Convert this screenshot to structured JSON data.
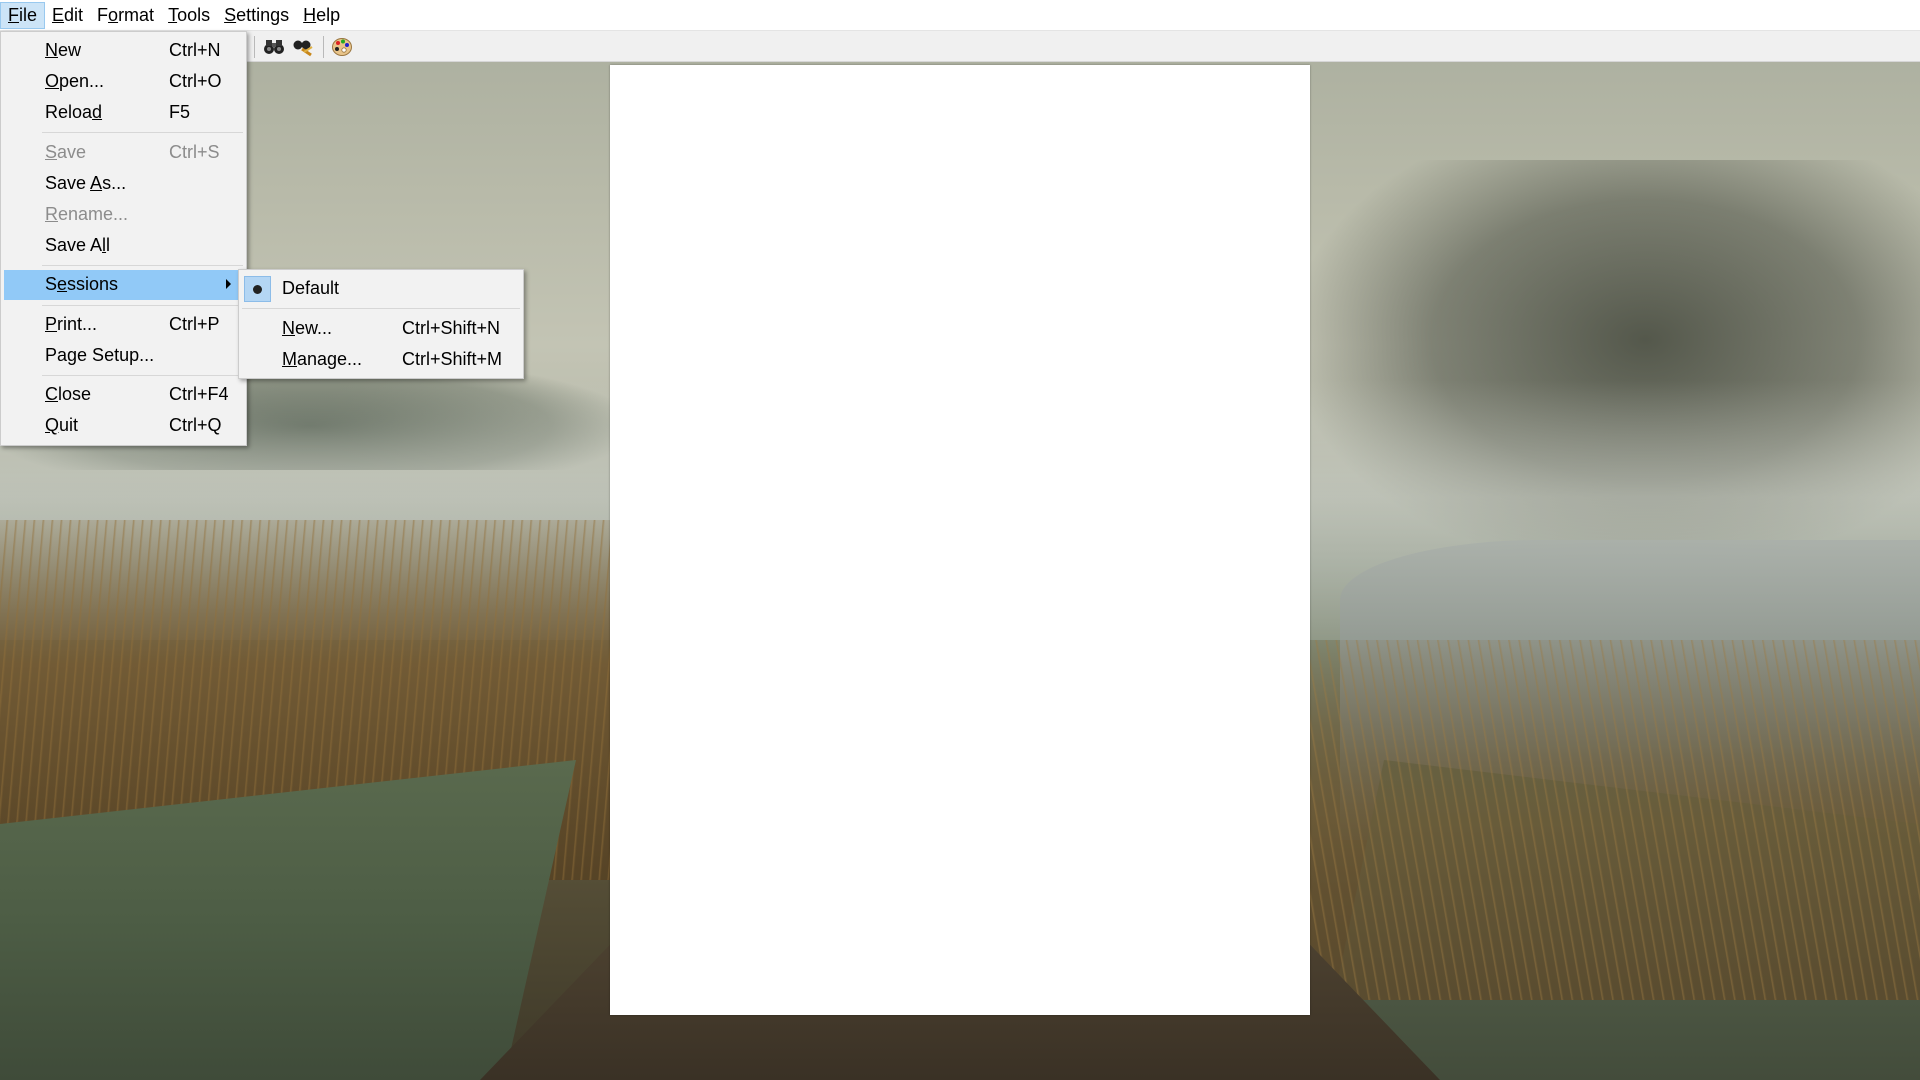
{
  "menubar": {
    "items": [
      {
        "pre": "",
        "mn": "F",
        "post": "ile"
      },
      {
        "pre": "",
        "mn": "E",
        "post": "dit"
      },
      {
        "pre": "F",
        "mn": "o",
        "post": "rmat"
      },
      {
        "pre": "",
        "mn": "T",
        "post": "ools"
      },
      {
        "pre": "",
        "mn": "S",
        "post": "ettings"
      },
      {
        "pre": "",
        "mn": "H",
        "post": "elp"
      }
    ]
  },
  "toolbar": {
    "icons": [
      "find-binoculars-icon",
      "find-replace-icon",
      "color-palette-icon"
    ]
  },
  "file_menu": {
    "new": {
      "pre": "",
      "mn": "N",
      "post": "ew",
      "shortcut": "Ctrl+N"
    },
    "open": {
      "pre": "",
      "mn": "O",
      "post": "pen...",
      "shortcut": "Ctrl+O"
    },
    "reload": {
      "pre": "Reloa",
      "mn": "d",
      "post": "",
      "shortcut": "F5"
    },
    "save": {
      "pre": "",
      "mn": "S",
      "post": "ave",
      "shortcut": "Ctrl+S"
    },
    "save_as": {
      "pre": "Save ",
      "mn": "A",
      "post": "s...",
      "shortcut": ""
    },
    "rename": {
      "pre": "",
      "mn": "R",
      "post": "ename...",
      "shortcut": ""
    },
    "save_all": {
      "pre": "Save A",
      "mn": "l",
      "post": "l",
      "shortcut": ""
    },
    "sessions": {
      "pre": "S",
      "mn": "e",
      "post": "ssions"
    },
    "print": {
      "pre": "",
      "mn": "P",
      "post": "rint...",
      "shortcut": "Ctrl+P"
    },
    "page_setup": {
      "pre": "Pa",
      "mn": "g",
      "post": "e Setup...",
      "shortcut": ""
    },
    "close": {
      "pre": "",
      "mn": "C",
      "post": "lose",
      "shortcut": "Ctrl+F4"
    },
    "quit": {
      "pre": "",
      "mn": "Q",
      "post": "uit",
      "shortcut": "Ctrl+Q"
    }
  },
  "sessions_menu": {
    "default": {
      "label": "Default",
      "selected": true
    },
    "new": {
      "pre": "",
      "mn": "N",
      "post": "ew...",
      "shortcut": "Ctrl+Shift+N"
    },
    "manage": {
      "pre": "",
      "mn": "M",
      "post": "anage...",
      "shortcut": "Ctrl+Shift+M"
    }
  },
  "colors": {
    "menu_highlight": "#91c9f7",
    "menubar_active": "#cce4f7",
    "disabled_text": "#8c8c8c"
  }
}
